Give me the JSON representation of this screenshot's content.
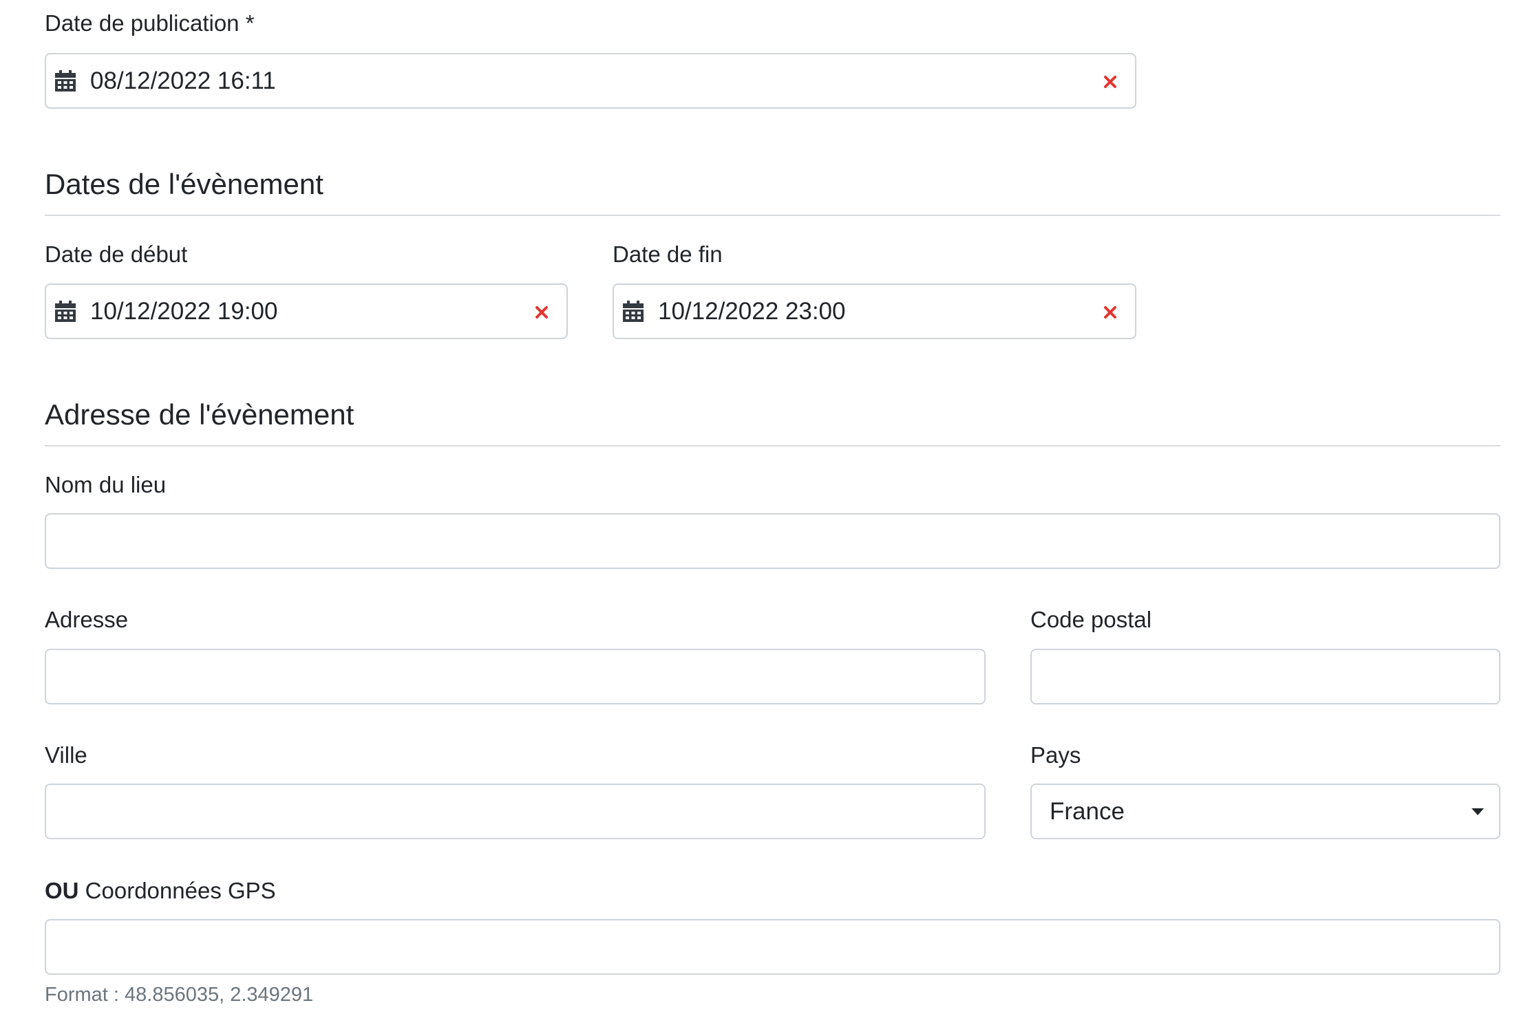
{
  "publication": {
    "label": "Date de publication *",
    "value": "08/12/2022 16:11"
  },
  "event_dates": {
    "title": "Dates de l'évènement",
    "start": {
      "label": "Date de début",
      "value": "10/12/2022 19:00"
    },
    "end": {
      "label": "Date de fin",
      "value": "10/12/2022 23:00"
    }
  },
  "event_address": {
    "title": "Adresse de l'évènement",
    "venue": {
      "label": "Nom du lieu",
      "value": ""
    },
    "address": {
      "label": "Adresse",
      "value": ""
    },
    "postal_code": {
      "label": "Code postal",
      "value": ""
    },
    "city": {
      "label": "Ville",
      "value": ""
    },
    "country": {
      "label": "Pays",
      "selected": "France"
    },
    "gps": {
      "label_prefix": "OU",
      "label": "Coordonnées GPS",
      "value": "",
      "help": "Format : 48.856035, 2.349291"
    }
  },
  "icons": {
    "calendar": "calendar-icon",
    "clear": "clear-x-icon",
    "dropdown": "caret-down-icon"
  },
  "colors": {
    "clear_icon": "#e3342f",
    "border": "#ced4da",
    "help_text": "#6c757d"
  }
}
